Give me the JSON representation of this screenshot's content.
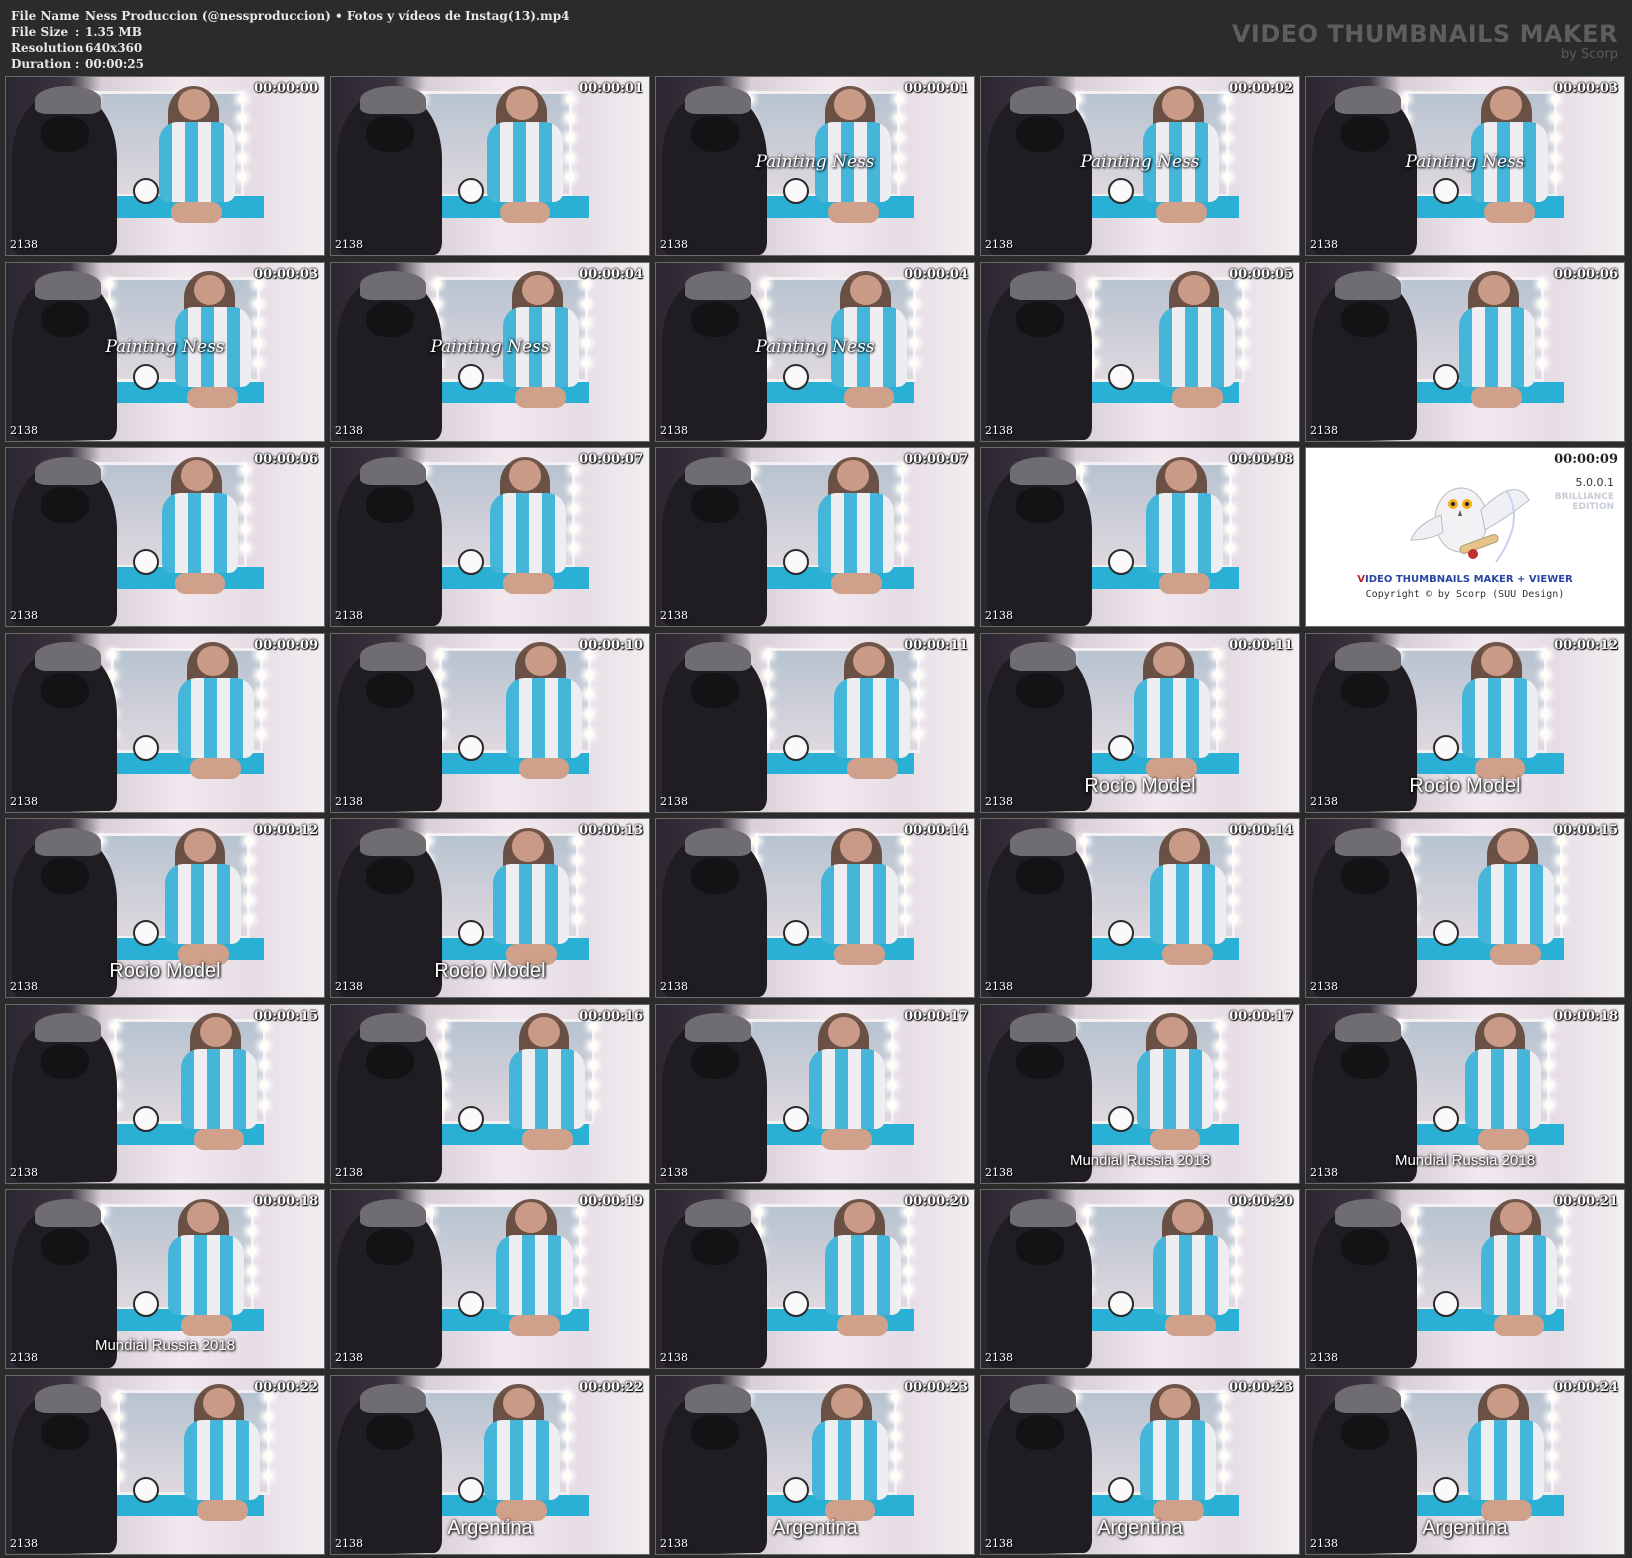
{
  "file_info": {
    "rows": [
      {
        "key": "File Name",
        "value": "Ness Produccion (@nessproduccion) • Fotos y vídeos de Instag(13).mp4"
      },
      {
        "key": "File Size",
        "value": "1.35 MB"
      },
      {
        "key": "Resolution",
        "value": "640x360"
      },
      {
        "key": "Duration",
        "value": "00:00:25"
      }
    ],
    "separator": ":"
  },
  "brand": {
    "title": "VIDEO THUMBNAILS MAKER",
    "subtitle": "by Scorp"
  },
  "watermark": "2138",
  "card": {
    "time": "00:00:09",
    "version": "5.0.0.1",
    "edition_line1": "BRILLIANCE",
    "edition_line2": "EDITION",
    "title_prefix": "V",
    "title_rest": "IDEO THUMBNAILS MAKER + VIEWER",
    "copyright": "Copyright © by Scorp (SUU Design)"
  },
  "thumbnails": [
    {
      "time": "00:00:00",
      "overlay": ""
    },
    {
      "time": "00:00:01",
      "overlay": ""
    },
    {
      "time": "00:00:01",
      "overlay": "Painting Ness",
      "style": "script"
    },
    {
      "time": "00:00:02",
      "overlay": "Painting Ness",
      "style": "script"
    },
    {
      "time": "00:00:03",
      "overlay": "Painting Ness",
      "style": "script"
    },
    {
      "time": "00:00:03",
      "overlay": "Painting Ness",
      "style": "script"
    },
    {
      "time": "00:00:04",
      "overlay": "Painting Ness",
      "style": "script"
    },
    {
      "time": "00:00:04",
      "overlay": "Painting Ness",
      "style": "script"
    },
    {
      "time": "00:00:05",
      "overlay": ""
    },
    {
      "time": "00:00:06",
      "overlay": ""
    },
    {
      "time": "00:00:06",
      "overlay": ""
    },
    {
      "time": "00:00:07",
      "overlay": ""
    },
    {
      "time": "00:00:07",
      "overlay": ""
    },
    {
      "time": "00:00:08",
      "overlay": ""
    },
    {
      "card": true
    },
    {
      "time": "00:00:09",
      "overlay": ""
    },
    {
      "time": "00:00:10",
      "overlay": ""
    },
    {
      "time": "00:00:11",
      "overlay": ""
    },
    {
      "time": "00:00:11",
      "overlay": "Rocio Model",
      "style": "low big"
    },
    {
      "time": "00:00:12",
      "overlay": "Rocio Model",
      "style": "low big"
    },
    {
      "time": "00:00:12",
      "overlay": "Rocio Model",
      "style": "low big"
    },
    {
      "time": "00:00:13",
      "overlay": "Rocio Model",
      "style": "low big"
    },
    {
      "time": "00:00:14",
      "overlay": ""
    },
    {
      "time": "00:00:14",
      "overlay": ""
    },
    {
      "time": "00:00:15",
      "overlay": ""
    },
    {
      "time": "00:00:15",
      "overlay": ""
    },
    {
      "time": "00:00:16",
      "overlay": ""
    },
    {
      "time": "00:00:17",
      "overlay": ""
    },
    {
      "time": "00:00:17",
      "overlay": "Mundial Russia 2018",
      "style": "low small"
    },
    {
      "time": "00:00:18",
      "overlay": "Mundial Russia 2018",
      "style": "low small"
    },
    {
      "time": "00:00:18",
      "overlay": "Mundial Russia 2018",
      "style": "low small"
    },
    {
      "time": "00:00:19",
      "overlay": ""
    },
    {
      "time": "00:00:20",
      "overlay": ""
    },
    {
      "time": "00:00:20",
      "overlay": ""
    },
    {
      "time": "00:00:21",
      "overlay": ""
    },
    {
      "time": "00:00:22",
      "overlay": ""
    },
    {
      "time": "00:00:22",
      "overlay": "Argentina",
      "style": "low big"
    },
    {
      "time": "00:00:23",
      "overlay": "Argentina",
      "style": "low big"
    },
    {
      "time": "00:00:23",
      "overlay": "Argentina",
      "style": "low big"
    },
    {
      "time": "00:00:24",
      "overlay": "Argentina",
      "style": "low big"
    }
  ],
  "colors": {
    "background": "#2b2b2b",
    "stripe_blue": "#45b6d9",
    "counter": "#29b0d4"
  }
}
